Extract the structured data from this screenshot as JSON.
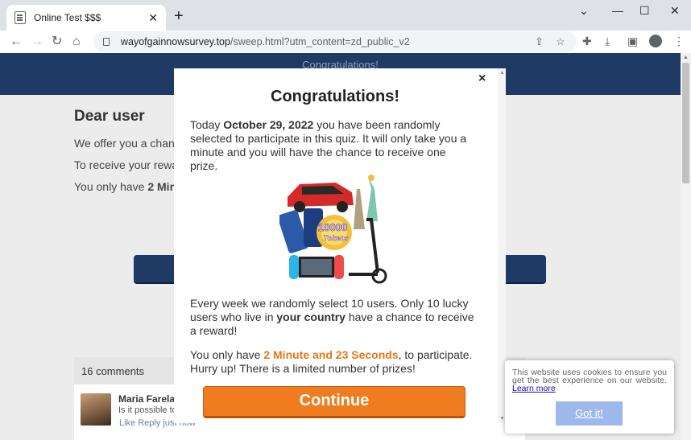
{
  "browser": {
    "tab_title": "Online Test $$$",
    "url_host": "wayofgainnowsurvey.top",
    "url_path": "/sweep.html?utm_content=zd_public_v2"
  },
  "page": {
    "banner_text": "Congratulations!",
    "greeting": "Dear user",
    "line1": "We offer you a chanc",
    "line2": "To receive your rewa",
    "line3_prefix": "You only have ",
    "line3_bold": "2 Minu",
    "comments_header": "16 comments",
    "comment_name": "Maria Farela",
    "comment_text": "Is it possible to",
    "comment_actions": "Like Reply  just now"
  },
  "modal": {
    "close_glyph": "×",
    "title": "Congratulations!",
    "p1_prefix": "Today ",
    "p1_date": "October 29, 2022",
    "p1_suffix": " you have been randomly selected to participate in this quiz. It will only take you a minute and you will have the chance to receive one prize.",
    "prize_text_top": "10000",
    "prize_text_bottom": "Tokens",
    "p2_prefix": "Every week we randomly select 10 users. Only 10 lucky users who live in ",
    "p2_bold": "your country",
    "p2_suffix": " have a chance to receive a reward!",
    "p3_prefix": "You only have ",
    "p3_time": "2 Minute and 23 Seconds",
    "p3_suffix": ", to participate. Hurry up! There is a limited number of prizes!",
    "continue_label": "Continue"
  },
  "cookie": {
    "text": "This website uses cookies to ensure you get the best experience on our website.",
    "learn_more": "Learn more",
    "button": "Got it!"
  },
  "colors": {
    "banner": "#1f3a64",
    "accent_orange": "#ef7c1f",
    "cookie_button": "#9fb8ec"
  }
}
